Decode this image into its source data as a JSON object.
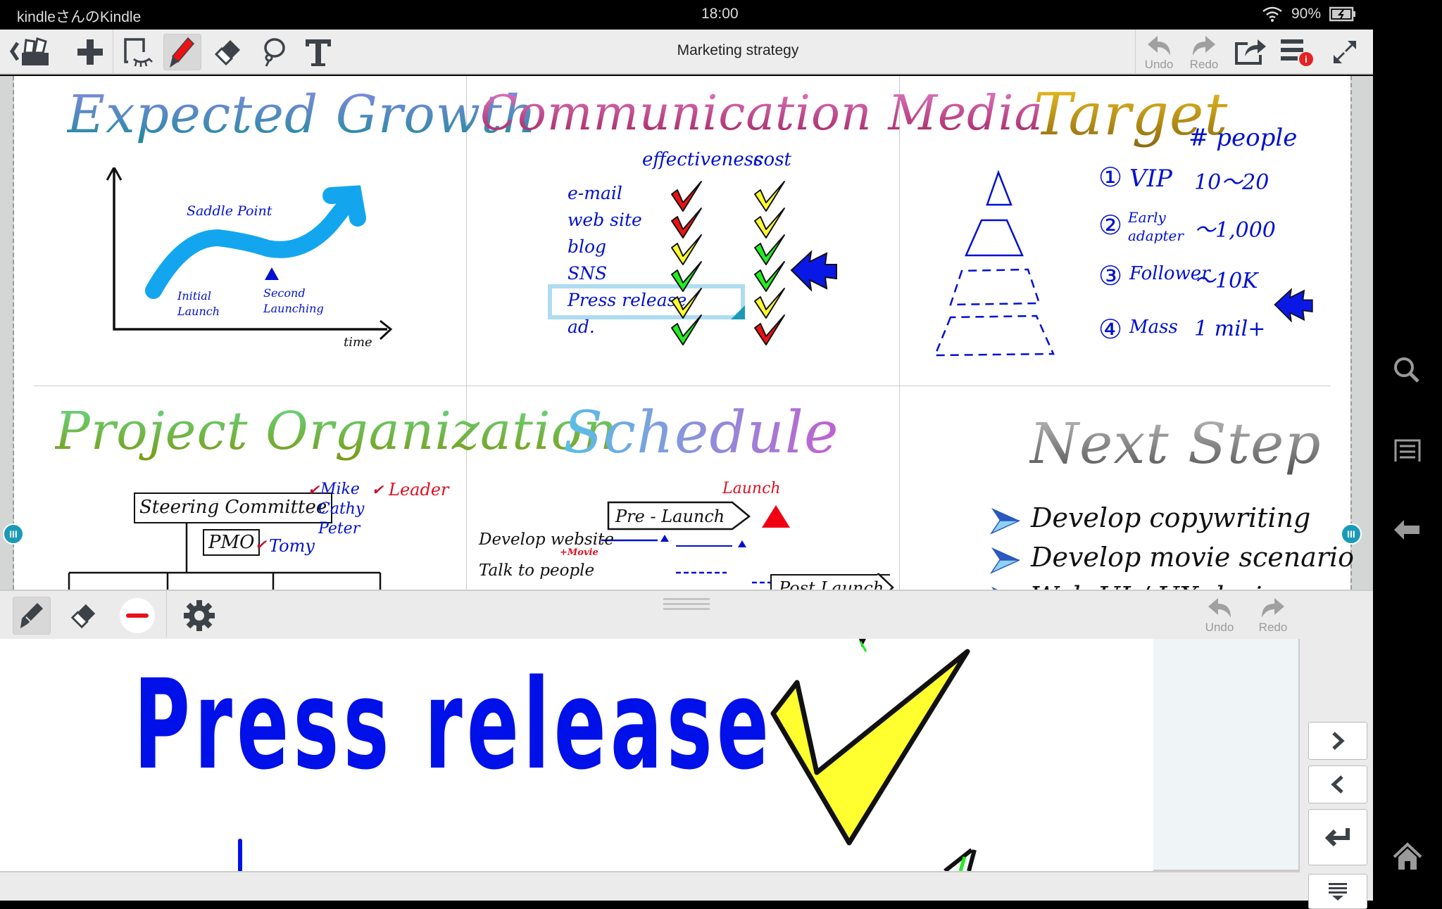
{
  "status_bar": {
    "device_name": "kindleさんのKindle",
    "time": "18:00",
    "battery": "90%",
    "icons": [
      "wifi-icon",
      "battery-charging-icon"
    ]
  },
  "toolbar": {
    "title": "Marketing strategy",
    "left_tools": [
      "back-to-notebooks",
      "add-page",
      "select-area",
      "pen",
      "eraser",
      "lasso",
      "text"
    ],
    "active_tool": "pen",
    "undo_label": "Undo",
    "redo_label": "Redo",
    "right_tools": [
      "undo",
      "redo",
      "share",
      "menu",
      "fullscreen"
    ],
    "menu_badge": "i"
  },
  "panels": {
    "expected_growth": {
      "title": "Expected Growth",
      "annotations": [
        "Saddle Point",
        "Initial Launch",
        "Second Launching"
      ],
      "x_axis_label": "time"
    },
    "communication_media": {
      "title": "Communication Media",
      "columns": [
        "effectiveness",
        "cost"
      ],
      "rows": [
        {
          "label": "e-mail",
          "effectiveness": "red",
          "cost": "yellow"
        },
        {
          "label": "web site",
          "effectiveness": "red",
          "cost": "yellow"
        },
        {
          "label": "blog",
          "effectiveness": "yellow",
          "cost": "green"
        },
        {
          "label": "SNS",
          "effectiveness": "green",
          "cost": "green"
        },
        {
          "label": "Press release",
          "effectiveness": "yellow",
          "cost": "yellow"
        },
        {
          "label": "ad.",
          "effectiveness": "green",
          "cost": "red"
        }
      ],
      "selected_row": "Press release"
    },
    "target": {
      "title": "Target",
      "column_header": "# people",
      "tiers": [
        {
          "num": "①",
          "name": "VIP",
          "count": "10～20"
        },
        {
          "num": "②",
          "name": "Early adapter",
          "count": "～1,000"
        },
        {
          "num": "③",
          "name": "Follower",
          "count": "～10K"
        },
        {
          "num": "④",
          "name": "Mass",
          "count": "1 mil+"
        }
      ],
      "highlighted_tier": "Early adapter"
    },
    "project_organization": {
      "title": "Project Organization",
      "boxes": [
        "Steering Committee",
        "PMO"
      ],
      "committee_members": [
        "Mike",
        "Cathy",
        "Peter"
      ],
      "leader_label": "Leader",
      "pmo_member": "Tomy"
    },
    "schedule": {
      "title": "Schedule",
      "milestone": "Launch",
      "phases": [
        "Pre - Launch",
        "Post Launch"
      ],
      "tasks": [
        "Develop website",
        "Talk to people"
      ],
      "task_note": "+Movie"
    },
    "next_step": {
      "title": "Next Step",
      "items": [
        "Develop copywriting",
        "Develop movie scenario",
        "Web UI / UX design"
      ]
    }
  },
  "pen_toolbar": {
    "tools": [
      "pen",
      "eraser",
      "color-red-line",
      "settings"
    ],
    "active_tool": "pen",
    "undo_label": "Undo",
    "redo_label": "Redo"
  },
  "input_area": {
    "zoomed_text": "Press release"
  },
  "keys": [
    "next",
    "previous",
    "enter",
    "hide-keyboard"
  ],
  "side_nav": [
    "search",
    "menu",
    "back",
    "home"
  ]
}
